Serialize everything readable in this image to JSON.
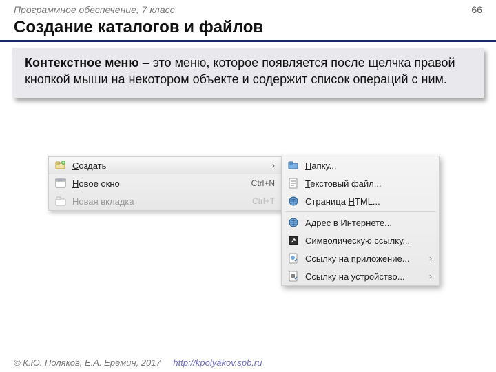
{
  "header": {
    "subject": "Программное обеспечение, 7 класс",
    "page": "66"
  },
  "title": "Создание каталогов и файлов",
  "definition": {
    "term": "Контекстное меню",
    "rest": " – это меню, которое появляется после щелчка правой кнопкой мыши на некотором объекте и содержит список операций с ним."
  },
  "menu1": {
    "items": [
      {
        "label_pre": "",
        "label_u": "С",
        "label_post": "оздать",
        "shortcut": "",
        "has_sub": true,
        "dim": false,
        "selected": true,
        "icon": "folder-new"
      },
      {
        "label_pre": "",
        "label_u": "Н",
        "label_post": "овое окно",
        "shortcut": "Ctrl+N",
        "has_sub": false,
        "dim": false,
        "selected": false,
        "icon": "window"
      },
      {
        "label_pre": "Новая вкладка",
        "label_u": "",
        "label_post": "",
        "shortcut": "Ctrl+T",
        "has_sub": false,
        "dim": true,
        "selected": false,
        "icon": "tab"
      }
    ]
  },
  "menu2": {
    "groups": [
      [
        {
          "label_pre": "",
          "label_u": "П",
          "label_post": "апку...",
          "icon": "folder",
          "has_sub": false
        },
        {
          "label_pre": "",
          "label_u": "Т",
          "label_post": "екстовый файл...",
          "icon": "text",
          "has_sub": false
        },
        {
          "label_pre": "Страница ",
          "label_u": "H",
          "label_post": "TML...",
          "icon": "globe",
          "has_sub": false
        }
      ],
      [
        {
          "label_pre": "Адрес в ",
          "label_u": "И",
          "label_post": "нтернете...",
          "icon": "globe",
          "has_sub": false
        },
        {
          "label_pre": "",
          "label_u": "С",
          "label_post": "имволическую ссылку...",
          "icon": "shortcut",
          "has_sub": false
        },
        {
          "label_pre": "Ссылку на приложение...",
          "label_u": "",
          "label_post": "",
          "icon": "app-link",
          "has_sub": true
        },
        {
          "label_pre": "Ссылку на устройство...",
          "label_u": "",
          "label_post": "",
          "icon": "device-link",
          "has_sub": true
        }
      ]
    ]
  },
  "footer": {
    "copyright": "© К.Ю. Поляков, Е.А. Ерёмин, 2017",
    "link": "http://kpolyakov.spb.ru"
  },
  "icons": {
    "folder-new": "<svg viewBox='0 0 18 18'><rect x='2' y='6' width='13' height='8' rx='1' fill='#f3e2a8' stroke='#b89a3a'/><rect x='2' y='4' width='6' height='3' rx='1' fill='#f3e2a8' stroke='#b89a3a'/><circle cx='13' cy='5' r='3' fill='#5fbf4d'/><path d='M13 3.5v3M11.5 5h3' stroke='#fff' stroke-width='1'/></svg>",
    "window": "<svg viewBox='0 0 18 18'><rect x='2' y='3' width='14' height='12' rx='1' fill='#fff' stroke='#888'/><rect x='2' y='3' width='14' height='3' fill='#cfd8e6' stroke='#888'/></svg>",
    "tab": "<svg viewBox='0 0 18 18'><rect x='2' y='6' width='14' height='9' rx='1' fill='#fff' stroke='#bbb'/><rect x='3' y='3' width='6' height='4' rx='1' fill='#eee' stroke='#bbb'/></svg>",
    "folder": "<svg viewBox='0 0 18 18'><rect x='2' y='6' width='13' height='8' rx='1' fill='#7fb4e8' stroke='#3a6fa8'/><rect x='2' y='4' width='6' height='3' rx='1' fill='#7fb4e8' stroke='#3a6fa8'/></svg>",
    "text": "<svg viewBox='0 0 18 18'><rect x='3' y='2' width='11' height='14' rx='1' fill='#fff' stroke='#999'/><path d='M5 6h7M5 9h7M5 12h5' stroke='#888' stroke-width='1'/></svg>",
    "globe": "<svg viewBox='0 0 18 18'><circle cx='9' cy='9' r='6' fill='#6fa8dc' stroke='#2b5a8a'/><path d='M3 9h12M9 3v12M5 5c2 2 6 2 8 0M5 13c2-2 6-2 8 0' stroke='#2b5a8a' stroke-width='0.7' fill='none'/></svg>",
    "shortcut": "<svg viewBox='0 0 18 18'><rect x='3' y='3' width='12' height='12' rx='1' fill='#333' stroke='#111'/><path d='M6 12l5-5M11 7h-3M11 7v3' stroke='#fff' stroke-width='1.2' fill='none'/></svg>",
    "app-link": "<svg viewBox='0 0 18 18'><rect x='3' y='2' width='11' height='14' rx='1' fill='#fff' stroke='#999'/><circle cx='8' cy='8' r='3' fill='#6fa8dc'/><path d='M11 13l3-3' stroke='#3a6fa8' stroke-width='1.5'/></svg>",
    "device-link": "<svg viewBox='0 0 18 18'><rect x='3' y='2' width='11' height='14' rx='1' fill='#fff' stroke='#999'/><rect x='6' y='6' width='5' height='5' fill='#888'/><path d='M11 13l3-3' stroke='#3a6fa8' stroke-width='1.5'/></svg>"
  }
}
